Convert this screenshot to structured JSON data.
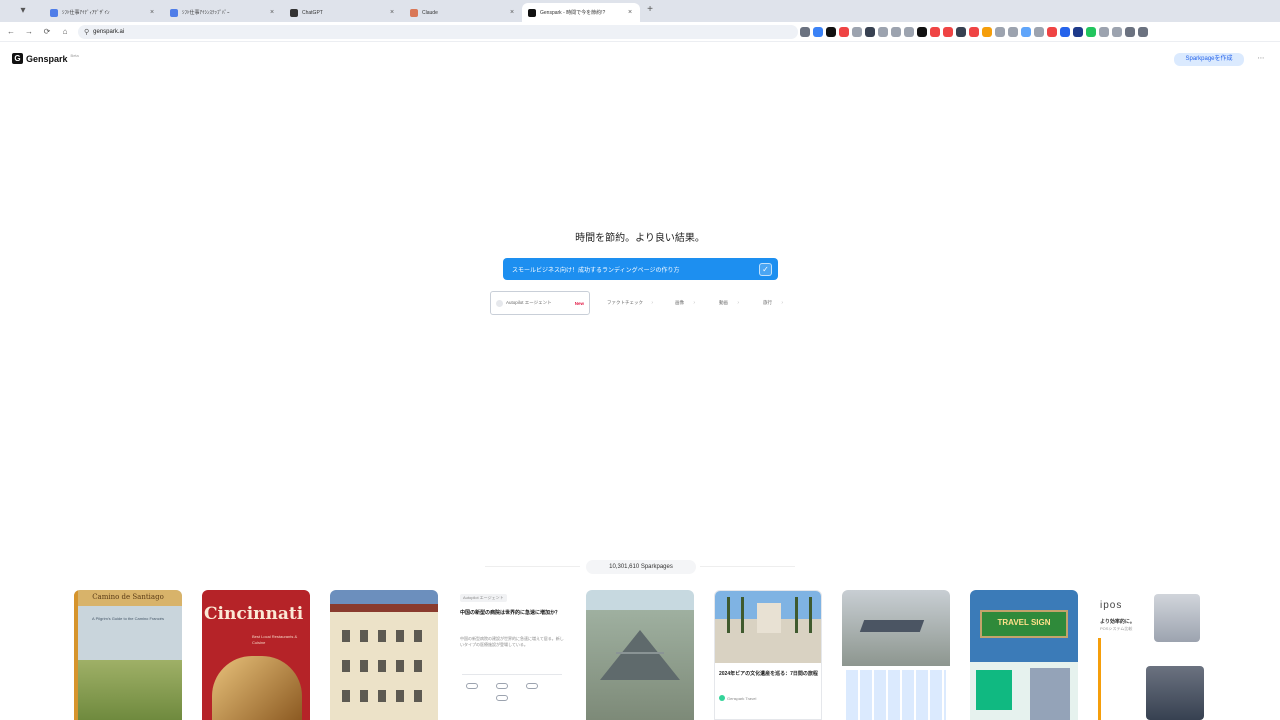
{
  "browser": {
    "tabs": [
      {
        "title": "ｼﾌﾄ仕事ｱｲﾃﾞｨｱﾃﾞｻﾞｲﾝ",
        "favicon_color": "#4f7de8",
        "active": false
      },
      {
        "title": "ｼﾌﾄ仕事ｱｲｼﾝｽﾃｯﾌﾟﾊﾟｰ",
        "favicon_color": "#4f7de8",
        "active": false
      },
      {
        "title": "ChatGPT",
        "favicon_color": "#333333",
        "active": false
      },
      {
        "title": "Claude",
        "favicon_color": "#d97757",
        "active": false
      },
      {
        "title": "Genspark - 時間で今を節約!?",
        "favicon_color": "#111111",
        "active": true
      }
    ],
    "close_glyph": "×",
    "new_tab_glyph": "+",
    "url": "genspark.ai",
    "back_glyph": "←",
    "forward_glyph": "→",
    "reload_glyph": "⟳",
    "home_glyph": "⌂",
    "lock_glyph": "⚲",
    "extensions": [
      {
        "name": "screen-cast-icon",
        "color": "#6b7280"
      },
      {
        "name": "star-icon",
        "color": "#3b82f6"
      },
      {
        "name": "notion-icon",
        "color": "#111111"
      },
      {
        "name": "youtube-icon",
        "color": "#ef4444"
      },
      {
        "name": "puzzle-icon",
        "color": "#9ca3af"
      },
      {
        "name": "pen-icon",
        "color": "#374151"
      },
      {
        "name": "translate-icon",
        "color": "#9ca3af"
      },
      {
        "name": "grid-icon",
        "color": "#9ca3af"
      },
      {
        "name": "note-icon",
        "color": "#9ca3af"
      },
      {
        "name": "x-icon",
        "color": "#111111"
      },
      {
        "name": "record-icon",
        "color": "#ef4444"
      },
      {
        "name": "record2-icon",
        "color": "#ef4444"
      },
      {
        "name": "shield-icon",
        "color": "#374151"
      },
      {
        "name": "pin-icon",
        "color": "#ef4444"
      },
      {
        "name": "spark-icon",
        "color": "#f59e0b"
      },
      {
        "name": "list-icon",
        "color": "#9ca3af"
      },
      {
        "name": "chat-icon",
        "color": "#9ca3af"
      },
      {
        "name": "cloud-icon",
        "color": "#60a5fa"
      },
      {
        "name": "mail-icon",
        "color": "#9ca3af"
      },
      {
        "name": "red-dot-icon",
        "color": "#ef4444"
      },
      {
        "name": "blue-square-icon",
        "color": "#2563eb"
      },
      {
        "name": "navy-icon",
        "color": "#1e3a8a"
      },
      {
        "name": "green-icon",
        "color": "#22c55e"
      },
      {
        "name": "doc-icon",
        "color": "#9ca3af"
      },
      {
        "name": "timer-icon",
        "color": "#9ca3af"
      },
      {
        "name": "profile-icon",
        "color": "#6b7280"
      },
      {
        "name": "menu-dots-icon",
        "color": "#6b7280"
      }
    ]
  },
  "app": {
    "logo_mark": "G",
    "logo_text": "Genspark",
    "logo_badge": "Beta",
    "signup_label": "Sparkpageを作成",
    "more_glyph": "⋯"
  },
  "hero": {
    "tagline": "時間を節約。より良い結果。",
    "prompt_text": "スモールビジネス向け！成功するランディングページの作り方",
    "send_glyph": "✓",
    "chips": [
      {
        "label": "Autopilot エージェント",
        "badge": "New",
        "primary": true
      },
      {
        "label": "ファクトチェック",
        "badge": "",
        "primary": false
      },
      {
        "label": "画像",
        "badge": "",
        "primary": false
      },
      {
        "label": "動画",
        "badge": "",
        "primary": false
      },
      {
        "label": "旅行",
        "badge": "",
        "primary": false
      }
    ],
    "chip_arrow": "›"
  },
  "sparkpages": {
    "count_label": "10,301,610 Sparkpages",
    "cards": [
      {
        "title": "Camino de Santiago",
        "subtitle": "A Pilgrim's Guide to the Camino Francés"
      },
      {
        "title": "Cincinnati",
        "subtitle": "Best Local Restaurants & Cuisine"
      },
      {
        "title": ""
      },
      {
        "tag": "Autopilot エージェント",
        "title": "中国の新型の病院は世界的に急速に増加か？",
        "body": "中国の新型病院の建設が世界的に急速に増えて居る。新しいタイプの医療施設が登場している。"
      },
      {
        "title": ""
      },
      {
        "title": "2024年ビアの文化遺産を巡る：7日間の旅程",
        "source": "Genspark Travel"
      },
      {
        "title": ""
      },
      {
        "title": "TRAVEL SIGN"
      },
      {
        "brand": "ipos",
        "tagline": "より効率的に。",
        "tagline2": "POSシステム比較"
      }
    ]
  }
}
